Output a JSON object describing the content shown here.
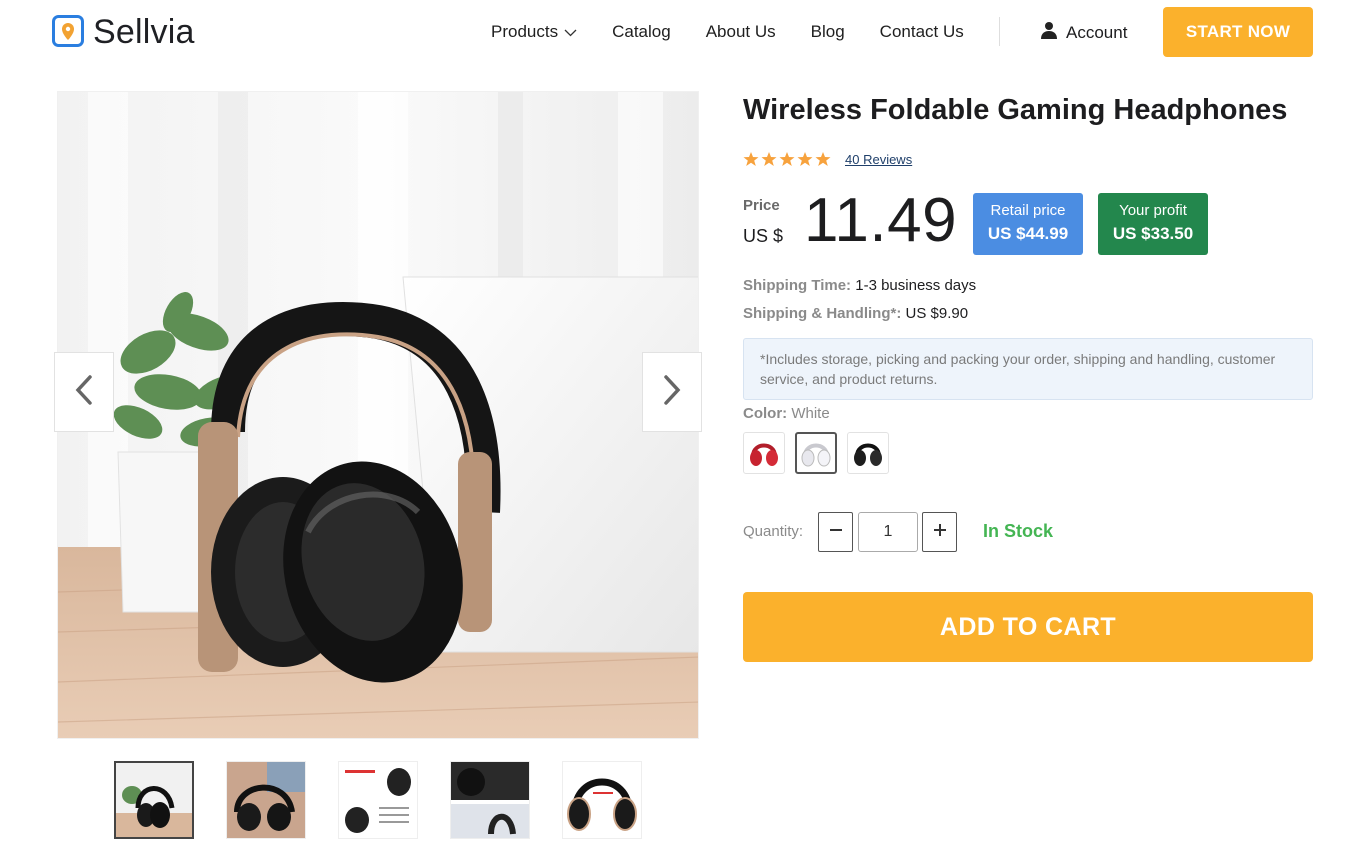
{
  "brand": {
    "name": "Sellvia",
    "logo_icon": "location-pin-icon",
    "color": "#2a7ee0"
  },
  "nav": {
    "items": [
      {
        "label": "Products",
        "has_dropdown": true
      },
      {
        "label": "Catalog"
      },
      {
        "label": "About Us"
      },
      {
        "label": "Blog"
      },
      {
        "label": "Contact Us"
      }
    ],
    "account_label": "Account",
    "account_icon": "user-icon",
    "cta_label": "START NOW",
    "cta_color": "#fbb12c"
  },
  "product": {
    "title": "Wireless Foldable Gaming Headphones",
    "rating": 5,
    "reviews_label": "40 Reviews",
    "price_label": "Price",
    "currency": "US $",
    "price": "11.49",
    "retail": {
      "label": "Retail price",
      "value": "US $44.99",
      "color": "#4b8de2"
    },
    "profit": {
      "label": "Your profit",
      "value": "US $33.50",
      "color": "#23874d"
    },
    "shipping_time": {
      "label": "Shipping Time:",
      "value": "1-3 business days"
    },
    "shipping_handling": {
      "label": "Shipping & Handling*:",
      "value": "US $9.90"
    },
    "note": "*Includes storage, picking and packing your order, shipping and handling, customer service, and product returns.",
    "color": {
      "label": "Color:",
      "value": "White",
      "options": [
        "Red",
        "White",
        "Black"
      ],
      "selected": "White"
    },
    "quantity": {
      "label": "Quantity:",
      "value": "1"
    },
    "stock": "In Stock",
    "stock_color": "#44b553",
    "cart_label": "ADD TO CART"
  },
  "gallery": {
    "thumb_count": 5,
    "active_thumb": 0,
    "prev_icon": "chevron-left-icon",
    "next_icon": "chevron-right-icon"
  }
}
